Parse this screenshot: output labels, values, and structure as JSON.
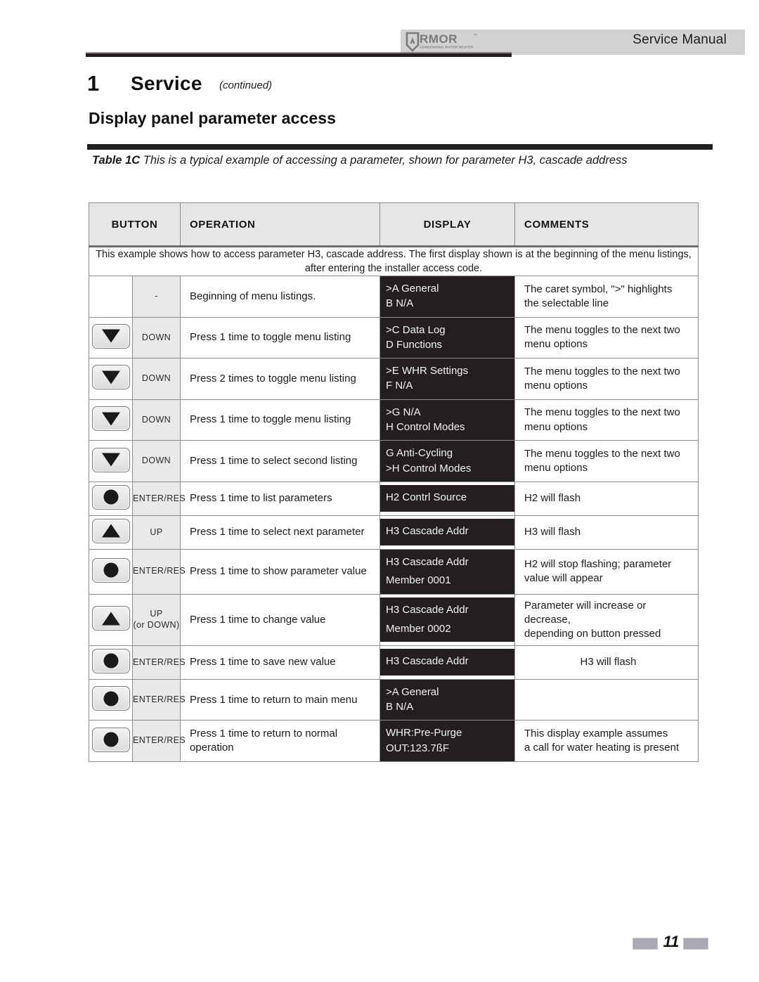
{
  "header": {
    "manual_label": "Service Manual",
    "logo_text": "ARMOR",
    "logo_tagline": "CONDENSING WATER HEATER",
    "logo_tm": "™"
  },
  "section": {
    "number": "1",
    "title": "Service",
    "continued": "(continued)",
    "subtitle": "Display panel parameter access"
  },
  "table_caption": {
    "label": "Table 1C",
    "text": " This is a typical example of accessing a parameter, shown for parameter H3, cascade address"
  },
  "table": {
    "columns": {
      "button": "BUTTON",
      "operation": "OPERATION",
      "display": "DISPLAY",
      "comments": "COMMENTS"
    },
    "intro": "This example shows how to access parameter H3, cascade address.  The first display shown is at the beginning of the menu listings, after entering the installer access code.",
    "rows": [
      {
        "icon": "none",
        "button_label": "-",
        "operation": "Beginning of menu listings.",
        "display_line1": ">A General",
        "display_line2": "B N/A",
        "comment_line1": "The caret symbol, \">\" highlights",
        "comment_line2": "the selectable line",
        "comment_center": false
      },
      {
        "icon": "down-arrow-icon",
        "button_label": "DOWN",
        "operation": "Press 1 time to toggle menu listing",
        "display_line1": ">C Data Log",
        "display_line2": " D Functions",
        "comment_line1": "The menu toggles to the next two",
        "comment_line2": "menu options",
        "comment_center": false
      },
      {
        "icon": "down-arrow-icon",
        "button_label": "DOWN",
        "operation": "Press 2 times to toggle menu listing",
        "display_line1": ">E WHR Settings",
        "display_line2": " F N/A",
        "comment_line1": "The menu toggles to the next two",
        "comment_line2": "menu options",
        "comment_center": false
      },
      {
        "icon": "down-arrow-icon",
        "button_label": "DOWN",
        "operation": "Press 1 time to toggle menu listing",
        "display_line1": ">G N/A",
        "display_line2": " H Control Modes",
        "comment_line1": "The menu toggles to the next two",
        "comment_line2": "menu options",
        "comment_center": false
      },
      {
        "icon": "down-arrow-icon",
        "button_label": "DOWN",
        "operation": "Press 1 time to select second listing",
        "display_line1": " G Anti-Cycling",
        "display_line2": ">H Control Modes",
        "comment_line1": "The menu toggles to the next two",
        "comment_line2": "menu options",
        "comment_center": false
      },
      {
        "icon": "enter-circle-icon",
        "button_label": "ENTER/RES",
        "operation": "Press 1 time to list parameters",
        "display_line1": " H2 Contrl Source",
        "display_line2": "",
        "comment_line1": "H2 will flash",
        "comment_line2": "",
        "comment_center": false
      },
      {
        "icon": "up-arrow-icon",
        "button_label": "UP",
        "operation": "Press 1 time to select next parameter",
        "display_line1": "H3 Cascade Addr",
        "display_line2": "",
        "comment_line1": "H3 will flash",
        "comment_line2": "",
        "comment_center": false
      },
      {
        "icon": "enter-circle-icon",
        "button_label": "ENTER/RES",
        "operation": "Press 1 time to show parameter value",
        "display_line1": "H3  Cascade Addr",
        "display_line2": "Member 0001",
        "comment_line1": "H2 will stop flashing; parameter",
        "comment_line2": "value will appear",
        "comment_center": false
      },
      {
        "icon": "up-arrow-icon",
        "button_label": "UP",
        "button_label2": "(or  DOWN)",
        "operation": "Press 1 time to change value",
        "display_line1": "H3  Cascade Addr",
        "display_line2": "Member 0002",
        "comment_line1": "Parameter will increase or decrease,",
        "comment_line2": "depending on button pressed",
        "comment_center": false
      },
      {
        "icon": "enter-circle-icon",
        "button_label": "ENTER/RES",
        "operation": "Press 1 time to save new value",
        "display_line1": "H3 Cascade Addr",
        "display_line2": "",
        "comment_line1": "H3 will flash",
        "comment_line2": "",
        "comment_center": true
      },
      {
        "icon": "enter-circle-icon",
        "button_label": "ENTER/RES",
        "operation": "Press 1 time to return to main menu",
        "display_line1": ">A General",
        "display_line2": " B N/A",
        "comment_line1": "",
        "comment_line2": "",
        "comment_center": false
      },
      {
        "icon": "enter-circle-icon",
        "button_label": "ENTER/RES",
        "operation": "Press 1 time to return to normal operation",
        "display_line1": "WHR:Pre-Purge",
        "display_line2": "OUT:123.7ßF",
        "comment_line1": "This display example assumes",
        "comment_line2": "a call for water heating is present",
        "comment_center": false
      }
    ]
  },
  "footer": {
    "page_number": "11"
  },
  "colors": {
    "header_band": "#d2d2d2",
    "rule": "#231f20",
    "table_header_bg": "#e6e6e6",
    "button_label_bg": "#e9e9e9",
    "lcd_bg": "#231f20",
    "lcd_text": "#f2f2f2",
    "footer_box": "#a9a9b4"
  }
}
